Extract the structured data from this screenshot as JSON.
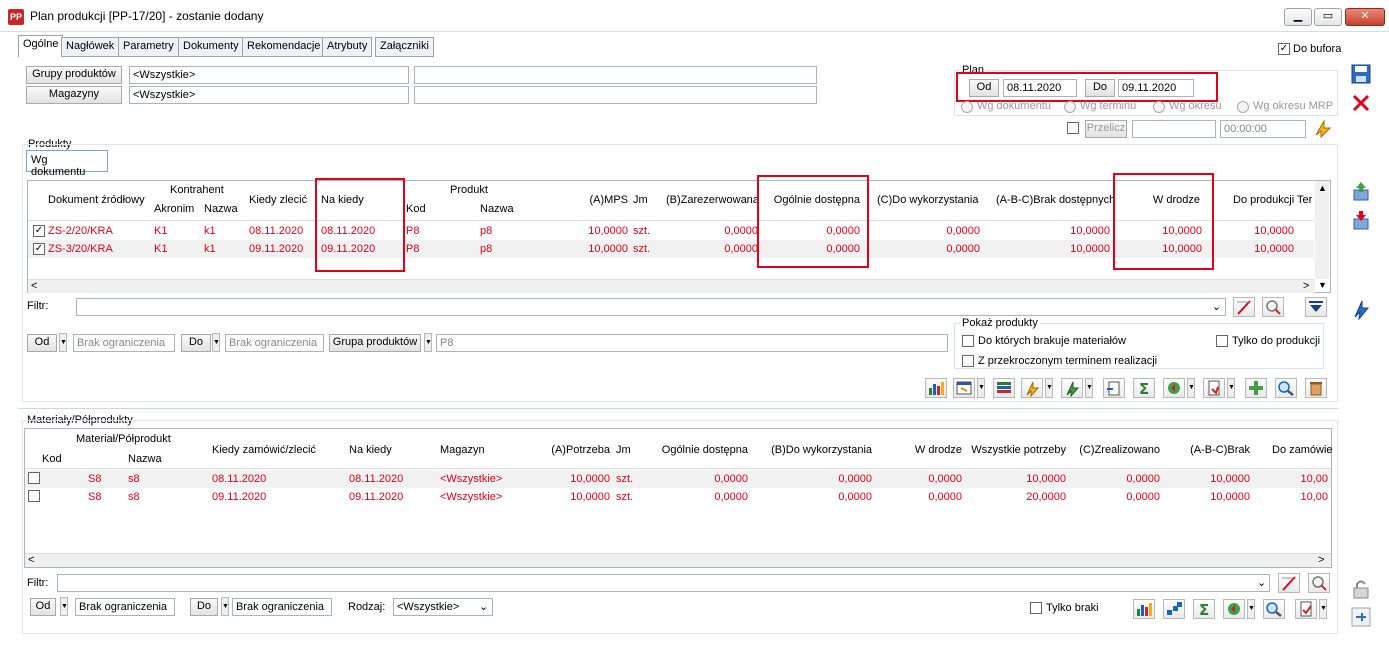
{
  "window": {
    "app_icon": "PP",
    "title": "Plan produkcji [PP-17/20] - zostanie dodany",
    "controls": [
      "minimize",
      "maximize",
      "close"
    ]
  },
  "tabs": [
    "Ogólne",
    "Nagłówek",
    "Parametry",
    "Dokumenty",
    "Rekomendacje",
    "Atrybuty",
    "Załączniki"
  ],
  "do_bufora": {
    "label": "Do bufora",
    "checked": "✓"
  },
  "filters": {
    "grupy_produktow_btn": "Grupy produktów",
    "grupy_value": "<Wszystkie>",
    "magazyny_btn": "Magazyny",
    "magazyny_value": "<Wszystkie>"
  },
  "plan": {
    "label": "Plan",
    "od_btn": "Od",
    "od_value": "08.11.2020",
    "do_btn": "Do",
    "do_value": "09.11.2020",
    "radios": [
      "Wg dokumentu",
      "Wg terminu",
      "Wg okresu",
      "Wg okresu MRP"
    ],
    "przelicz_btn": "Przelicz",
    "time_value": "00:00:00"
  },
  "produkty": {
    "label": "Produkty",
    "subtab": "Wg dokumentu",
    "group_headers": {
      "kontrahent": "Kontrahent",
      "produkt": "Produkt"
    },
    "columns": {
      "dokument": "Dokument źródłowy",
      "akronim": "Akronim",
      "nazwa": "Nazwa",
      "kiedy_zlecic": "Kiedy zlecić",
      "na_kiedy": "Na kiedy",
      "kod": "Kod",
      "p_nazwa": "Nazwa",
      "mps": "(A)MPS",
      "jm": "Jm",
      "zarezerwowana": "(B)Zarezerwowana",
      "ogolnie": "Ogólnie dostępna",
      "do_wykorzystania": "(C)Do wykorzystania",
      "brak": "(A-B-C)Brak dostępnych",
      "w_drodze": "W drodze",
      "do_produkcji": "Do produkcji",
      "termin": "Ter"
    },
    "rows": [
      {
        "check": "✓",
        "dokument": "ZS-2/20/KRA",
        "akronim": "K1",
        "nazwa": "k1",
        "kiedy_zlecic": "08.11.2020",
        "na_kiedy": "08.11.2020",
        "kod": "P8",
        "p_nazwa": "p8",
        "mps": "10,0000",
        "jm": "szt.",
        "zarezerwowana": "0,0000",
        "ogolnie": "0,0000",
        "do_wykorzystania": "0,0000",
        "brak": "10,0000",
        "w_drodze": "10,0000",
        "do_produkcji": "10,0000"
      },
      {
        "check": "✓",
        "dokument": "ZS-3/20/KRA",
        "akronim": "K1",
        "nazwa": "k1",
        "kiedy_zlecic": "09.11.2020",
        "na_kiedy": "09.11.2020",
        "kod": "P8",
        "p_nazwa": "p8",
        "mps": "10,0000",
        "jm": "szt.",
        "zarezerwowana": "0,0000",
        "ogolnie": "0,0000",
        "do_wykorzystania": "0,0000",
        "brak": "10,0000",
        "w_drodze": "10,0000",
        "do_produkcji": "10,0000"
      }
    ],
    "filtr_label": "Filtr:",
    "od_btn": "Od",
    "od_value": "Brak ograniczenia",
    "do_btn": "Do",
    "do_value": "Brak ograniczenia",
    "grupa_btn": "Grupa produktów",
    "grupa_value": "P8",
    "pokaz": {
      "label": "Pokaż produkty",
      "opt1": "Do których brakuje materiałów",
      "opt2": "Z przekroczonym terminem realizacji",
      "opt3": "Tylko do produkcji"
    }
  },
  "materialy": {
    "label": "Materiały/Półprodukty",
    "group_header": "Materiał/Półprodukt",
    "columns": {
      "kod": "Kod",
      "nazwa": "Nazwa",
      "kiedy": "Kiedy zamówić/zlecić",
      "na_kiedy": "Na kiedy",
      "magazyn": "Magazyn",
      "potrzeba": "(A)Potrzeba",
      "jm": "Jm",
      "ogolnie": "Ogólnie dostępna",
      "do_wykorzystania": "(B)Do wykorzystania",
      "w_drodze": "W drodze",
      "wszystkie": "Wszystkie potrzeby",
      "zrealizowano": "(C)Zrealizowano",
      "brak": "(A-B-C)Brak",
      "do_zamowienia": "Do zamówie"
    },
    "rows": [
      {
        "kod": "S8",
        "nazwa": "s8",
        "kiedy": "08.11.2020",
        "na_kiedy": "08.11.2020",
        "magazyn": "<Wszystkie>",
        "potrzeba": "10,0000",
        "jm": "szt.",
        "ogolnie": "0,0000",
        "do_wykorzystania": "0,0000",
        "w_drodze": "0,0000",
        "wszystkie": "10,0000",
        "zrealizowano": "0,0000",
        "brak": "10,0000",
        "do_zamowienia": "10,00"
      },
      {
        "kod": "S8",
        "nazwa": "s8",
        "kiedy": "09.11.2020",
        "na_kiedy": "09.11.2020",
        "magazyn": "<Wszystkie>",
        "potrzeba": "10,0000",
        "jm": "szt.",
        "ogolnie": "0,0000",
        "do_wykorzystania": "0,0000",
        "w_drodze": "0,0000",
        "wszystkie": "20,0000",
        "zrealizowano": "0,0000",
        "brak": "10,0000",
        "do_zamowienia": "10,00"
      }
    ],
    "filtr_label": "Filtr:",
    "od_btn": "Od",
    "od_value": "Brak ograniczenia",
    "do_btn": "Do",
    "do_value": "Brak ograniczenia",
    "rodzaj_label": "Rodzaj:",
    "rodzaj_value": "<Wszystkie>",
    "tylko_braki": "Tylko braki"
  },
  "colors": {
    "accent_red": "#e0001a",
    "tab_border": "#9aa4b1"
  }
}
